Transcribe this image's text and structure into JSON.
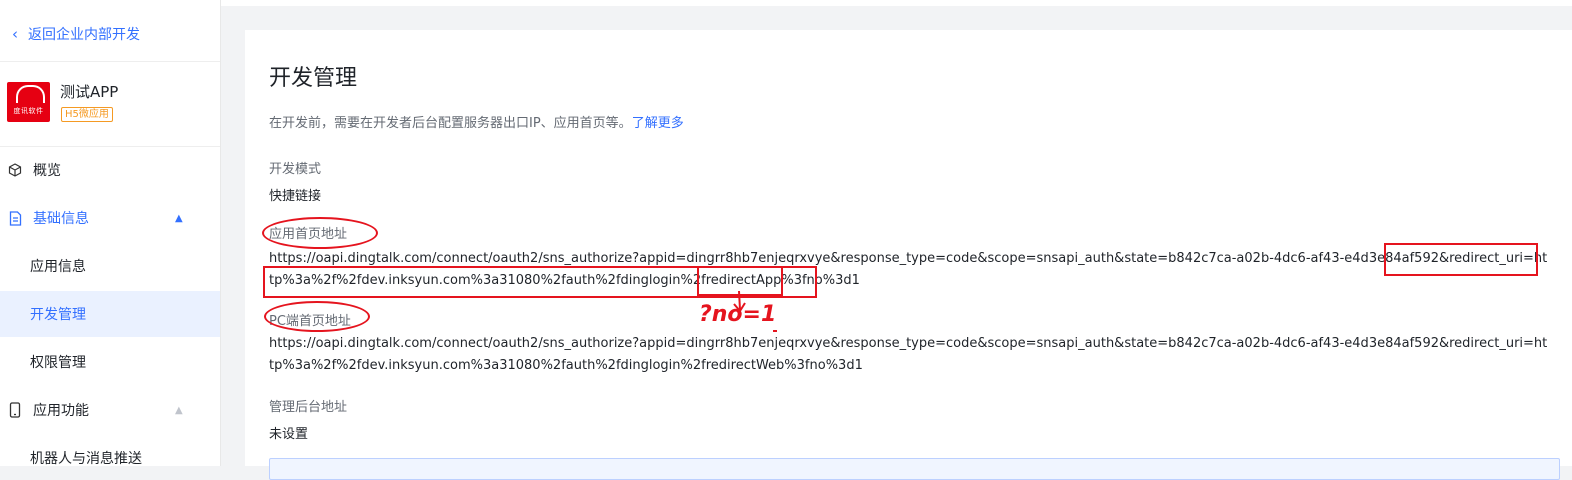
{
  "sidebar": {
    "back_label": "返回企业内部开发",
    "app": {
      "name": "测试APP",
      "badge": "H5微应用",
      "logo_text": "度讯软件"
    },
    "nav": [
      {
        "label": "概览",
        "icon": "cube-icon"
      },
      {
        "label": "基础信息",
        "icon": "document-icon",
        "expanded": true
      },
      {
        "label": "应用信息"
      },
      {
        "label": "开发管理",
        "active": true
      },
      {
        "label": "权限管理"
      },
      {
        "label": "应用功能",
        "icon": "phone-icon",
        "expanded": false
      },
      {
        "label": "机器人与消息推送"
      }
    ]
  },
  "main": {
    "title": "开发管理",
    "description": "在开发前，需要在开发者后台配置服务器出口IP、应用首页等。",
    "learn_more": "了解更多",
    "dev_mode_label": "开发模式",
    "dev_mode_value": "快捷链接",
    "home_url_label": "应用首页地址",
    "home_url": "https://oapi.dingtalk.com/connect/oauth2/sns_authorize?appid=dingrr8hb7enjeqrxvye&response_type=code&scope=snsapi_auth&state=b842c7ca-a02b-4dc6-af43-e4d3e84af592&redirect_uri=http%3a%2f%2fdev.inksyun.com%3a31080%2fauth%2fdinglogin%2fredirectApp%3fno%3d1",
    "pc_url_label": "PC端首页地址",
    "pc_url": "https://oapi.dingtalk.com/connect/oauth2/sns_authorize?appid=dingrr8hb7enjeqrxvye&response_type=code&scope=snsapi_auth&state=b842c7ca-a02b-4dc6-af43-e4d3e84af592&redirect_uri=http%3a%2f%2fdev.inksyun.com%3a31080%2fauth%2fdinglogin%2fredirectWeb%3fno%3d1",
    "admin_url_label": "管理后台地址",
    "admin_url_value": "未设置"
  },
  "annotations": {
    "decoded_param": "?no=1",
    "color": "#e5141e"
  },
  "colors": {
    "accent": "#3370ff",
    "active_bg": "#eaf1ff",
    "badge": "#f59a23",
    "logo": "#e60012"
  }
}
